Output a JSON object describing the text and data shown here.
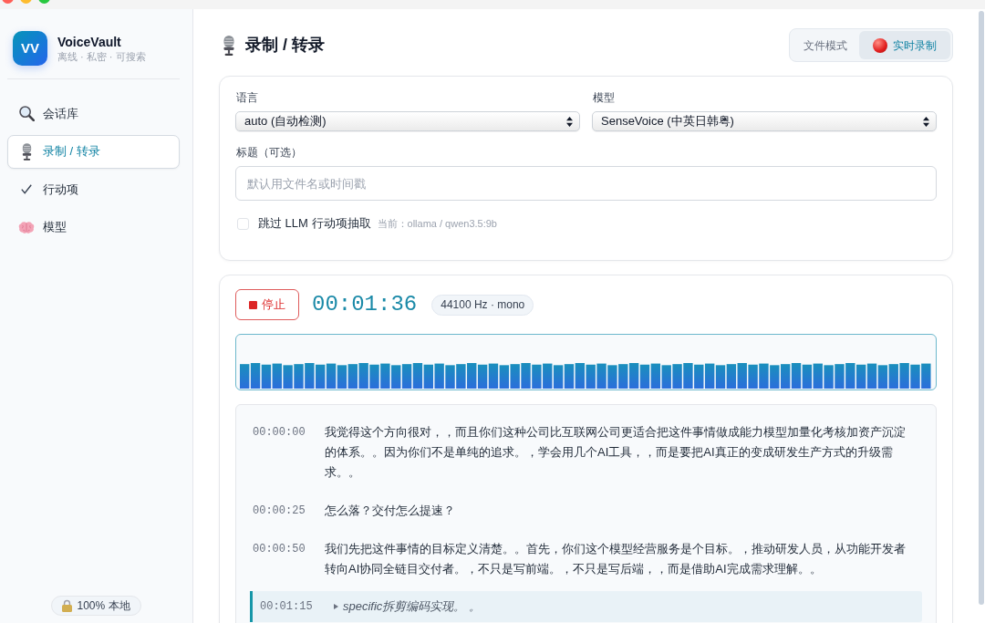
{
  "sidebar": {
    "logo": "VV",
    "app_name": "VoiceVault",
    "tagline": "离线 · 私密 · 可搜索",
    "items": [
      {
        "label": "会话库",
        "selected": false
      },
      {
        "label": "录制 / 转录",
        "selected": true
      },
      {
        "label": "行动项",
        "selected": false
      },
      {
        "label": "模型",
        "selected": false
      }
    ],
    "footer_badge": "100% 本地"
  },
  "header": {
    "title": "录制 / 转录",
    "mode_tabs": [
      {
        "label": "文件模式",
        "selected": false
      },
      {
        "label": "实时录制",
        "selected": true
      }
    ]
  },
  "settings": {
    "language": {
      "label": "语言",
      "value": "auto (自动检测)"
    },
    "model": {
      "label": "模型",
      "value": "SenseVoice (中英日韩粤)"
    },
    "title_field": {
      "label": "标题（可选）",
      "placeholder": "默认用文件名或时间戳"
    },
    "skip_llm": {
      "label": "跳过 LLM 行动项抽取",
      "checked": false,
      "hint": "当前：ollama / qwen3.5:9b"
    }
  },
  "recorder": {
    "stop_button": "停止",
    "elapsed": "00:01:36",
    "audio_format": "44100 Hz · mono"
  },
  "transcript": [
    {
      "time": "00:00:00",
      "text": "我觉得这个方向很对，，而且你们这种公司比互联网公司更适合把这件事情做成能力模型加量化考核加资产沉淀的体系。。因为你们不是单纯的追求。，学会用几个AI工具，，而是要把AI真正的变成研发生产方式的升级需求。。",
      "kind": "final"
    },
    {
      "time": "00:00:25",
      "text": "怎么落？交付怎么提速？",
      "kind": "final"
    },
    {
      "time": "00:00:50",
      "text": "我们先把这件事情的目标定义清楚。。首先，你们这个模型经营服务是个目标。，推动研发人员，从功能开发者转向AI协同全链目交付者。，不只是写前端。，不只是写后端，，而是借助AI完成需求理解。。",
      "kind": "final"
    },
    {
      "time": "00:01:15",
      "text": "specific拆剪编码实现。 。",
      "kind": "partial"
    }
  ]
}
